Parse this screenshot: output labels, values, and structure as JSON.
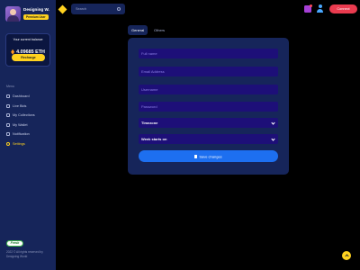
{
  "profile": {
    "name": "Designing W.",
    "badge": "Premium User"
  },
  "balance": {
    "label": "Your current balance",
    "value": "4.09685 ETH",
    "recharge_label": "Recharge"
  },
  "menu": {
    "heading": "Menu",
    "items": [
      {
        "label": "Dashboard",
        "icon": "dashboard-icon",
        "active": false
      },
      {
        "label": "Live Bids",
        "icon": "bids-icon",
        "active": false
      },
      {
        "label": "My Collections",
        "icon": "collections-icon",
        "active": false
      },
      {
        "label": "My Wallet",
        "icon": "wallet-icon",
        "active": false
      },
      {
        "label": "Notification",
        "icon": "bell-icon",
        "active": false
      },
      {
        "label": "Settings",
        "icon": "gear-icon",
        "active": true
      }
    ]
  },
  "footer": {
    "logo_text": "Fresh",
    "copyright": "2022 © All rights reserved by Designing World"
  },
  "topbar": {
    "search_placeholder": "Search",
    "connect_label": "Connect"
  },
  "tabs": [
    {
      "label": "General",
      "active": true
    },
    {
      "label": "Others",
      "active": false
    }
  ],
  "form": {
    "fullname_placeholder": "Full name",
    "email_placeholder": "Email Address",
    "username_placeholder": "Username",
    "password_placeholder": "Password",
    "timezone_label": "Timezone",
    "week_start_label": "Week starts on",
    "save_label": "Save changes"
  },
  "colors": {
    "sidebar": "#16255a",
    "accent": "#ffd21f",
    "primary": "#1d6ff0",
    "danger": "#ea3b4f",
    "field": "#1d0f78"
  }
}
